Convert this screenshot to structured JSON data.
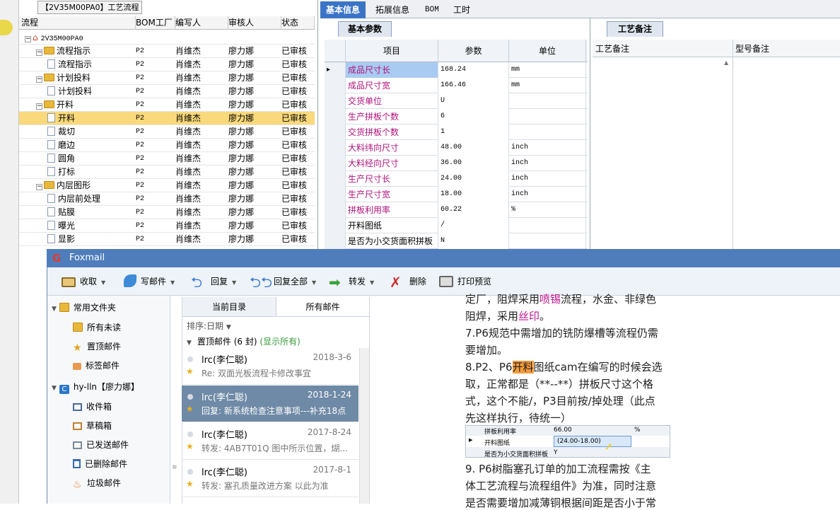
{
  "tree": {
    "title": "【2V35M00PA0】工艺流程",
    "columns": [
      "流程",
      "BOM工厂",
      "编写人",
      "审核人",
      "状态"
    ],
    "rows": [
      {
        "level": 0,
        "type": "root",
        "label": "2V35M00PA0",
        "factory": "",
        "author": "",
        "reviewer": "",
        "status": ""
      },
      {
        "level": 1,
        "type": "folder",
        "label": "流程指示",
        "factory": "P2",
        "author": "肖维杰",
        "reviewer": "廖力娜",
        "status": "已审核"
      },
      {
        "level": 2,
        "type": "doc",
        "label": "流程指示",
        "factory": "P2",
        "author": "肖维杰",
        "reviewer": "廖力娜",
        "status": "已审核"
      },
      {
        "level": 1,
        "type": "folder",
        "label": "计划投料",
        "factory": "P2",
        "author": "肖维杰",
        "reviewer": "廖力娜",
        "status": "已审核"
      },
      {
        "level": 2,
        "type": "doc",
        "label": "计划投料",
        "factory": "P2",
        "author": "肖维杰",
        "reviewer": "廖力娜",
        "status": "已审核"
      },
      {
        "level": 1,
        "type": "folder",
        "label": "开料",
        "factory": "P2",
        "author": "肖维杰",
        "reviewer": "廖力娜",
        "status": "已审核"
      },
      {
        "level": 2,
        "type": "doc",
        "label": "开料",
        "factory": "P2",
        "author": "肖维杰",
        "reviewer": "廖力娜",
        "status": "已审核",
        "selected": true
      },
      {
        "level": 2,
        "type": "doc",
        "label": "裁切",
        "factory": "P2",
        "author": "肖维杰",
        "reviewer": "廖力娜",
        "status": "已审核"
      },
      {
        "level": 2,
        "type": "doc",
        "label": "磨边",
        "factory": "P2",
        "author": "肖维杰",
        "reviewer": "廖力娜",
        "status": "已审核"
      },
      {
        "level": 2,
        "type": "doc",
        "label": "圆角",
        "factory": "P2",
        "author": "肖维杰",
        "reviewer": "廖力娜",
        "status": "已审核"
      },
      {
        "level": 2,
        "type": "doc",
        "label": "打标",
        "factory": "P2",
        "author": "肖维杰",
        "reviewer": "廖力娜",
        "status": "已审核"
      },
      {
        "level": 1,
        "type": "folder",
        "label": "内层图形",
        "factory": "P2",
        "author": "肖维杰",
        "reviewer": "廖力娜",
        "status": "已审核"
      },
      {
        "level": 2,
        "type": "doc",
        "label": "内层前处理",
        "factory": "P2",
        "author": "肖维杰",
        "reviewer": "廖力娜",
        "status": "已审核"
      },
      {
        "level": 2,
        "type": "doc",
        "label": "贴膜",
        "factory": "P2",
        "author": "肖维杰",
        "reviewer": "廖力娜",
        "status": "已审核"
      },
      {
        "level": 2,
        "type": "doc",
        "label": "曝光",
        "factory": "P2",
        "author": "肖维杰",
        "reviewer": "廖力娜",
        "status": "已审核"
      },
      {
        "level": 2,
        "type": "doc",
        "label": "显影",
        "factory": "P2",
        "author": "肖维杰",
        "reviewer": "廖力娜",
        "status": "已审核"
      }
    ]
  },
  "tabs": [
    "基本信息",
    "拓展信息",
    "BOM",
    "工时"
  ],
  "basic": {
    "subtab": "基本参数",
    "columns": [
      "项目",
      "参数",
      "单位"
    ],
    "rows": [
      {
        "item": "成品尺寸长",
        "value": "168.24",
        "unit": "mm"
      },
      {
        "item": "成品尺寸宽",
        "value": "166.46",
        "unit": "mm"
      },
      {
        "item": "交货单位",
        "value": "U",
        "unit": ""
      },
      {
        "item": "生产拼板个数",
        "value": "6",
        "unit": ""
      },
      {
        "item": "交货拼板个数",
        "value": "1",
        "unit": ""
      },
      {
        "item": "大料纬向尺寸",
        "value": "48.00",
        "unit": "inch"
      },
      {
        "item": "大料经向尺寸",
        "value": "36.00",
        "unit": "inch"
      },
      {
        "item": "生产尺寸长",
        "value": "24.00",
        "unit": "inch"
      },
      {
        "item": "生产尺寸宽",
        "value": "18.00",
        "unit": "inch"
      },
      {
        "item": "拼板利用率",
        "value": "60.22",
        "unit": "%"
      },
      {
        "item": "开料图纸",
        "value": "/",
        "unit": ""
      },
      {
        "item": "是否为小交货面积拼板",
        "value": "N",
        "unit": ""
      }
    ]
  },
  "notes": {
    "subtab": "工艺备注",
    "col1": "工艺备注",
    "col2": "型号备注"
  },
  "foxmail": {
    "title": "Foxmail",
    "toolbar": [
      "收取",
      "写邮件",
      "回复",
      "回复全部",
      "转发",
      "删除",
      "打印预览"
    ],
    "folders": [
      {
        "label": "常用文件夹",
        "kind": "group"
      },
      {
        "label": "所有未读",
        "kind": "item"
      },
      {
        "label": "置顶邮件",
        "kind": "item"
      },
      {
        "label": "标签邮件",
        "kind": "item"
      },
      {
        "label": "hy-lln【廖力娜】",
        "kind": "account"
      },
      {
        "label": "收件箱",
        "kind": "item"
      },
      {
        "label": "草稿箱",
        "kind": "item"
      },
      {
        "label": "已发送邮件",
        "kind": "item"
      },
      {
        "label": "已删除邮件",
        "kind": "item"
      },
      {
        "label": "垃圾邮件",
        "kind": "item"
      }
    ],
    "list_tabs": [
      "当前目录",
      "所有邮件"
    ],
    "sort": "排序:日期",
    "group_label": "置顶邮件 (6 封)",
    "group_show": "(显示所有)",
    "mails": [
      {
        "from": "lrc(李仁聪)",
        "date": "2018-3-6",
        "subject": "Re: 双面光板流程卡修改事宜"
      },
      {
        "from": "lrc(李仁聪)",
        "date": "2018-1-24",
        "subject": "回复: 新系统检查注意事项---补充18点",
        "selected": true
      },
      {
        "from": "lrc(李仁聪)",
        "date": "2017-8-24",
        "subject": "转发: 4AB7T01Q 图中所示位置，煳..."
      },
      {
        "from": "lrc(李仁聪)",
        "date": "2017-8-1",
        "subject": "转发: 塞孔质量改进方案 以此为准"
      }
    ],
    "body": {
      "l1a": "定厂，阻焊采用",
      "l1b": "喷锡",
      "l1c": "流程，水金、非绿色",
      "l2a": "阻焊，采用",
      "l2b": "丝印",
      "l2c": "。",
      "l3": "7.P6规范中需增加的铣防爆槽等流程仍需",
      "l4": "要增加。",
      "l5a": "8.P2、P6",
      "l5b": "开料",
      "l5c": "图纸cam在编写的时候会选",
      "l6": "取，正常都是（**--**）拼板尺寸这个格",
      "l7": "式，这个不能/，P3目前按/掉处理（此点",
      "l8": "先这样执行，待统一）",
      "l9": "9. P6树脂塞孔订单的加工流程需按《主",
      "l10": "体工艺流程与流程组件》为准，同时注意",
      "l11": "是否需要增加减薄铜根据间距是否小于常",
      "snip_r1a": "拼板利用率",
      "snip_r1b": "66.00",
      "snip_r1c": "%",
      "snip_r2a": "开料图纸",
      "snip_r2b": "(24.00-18.00)",
      "snip_r3a": "是否为小交货面积拼板",
      "snip_r3b": "Y"
    }
  }
}
